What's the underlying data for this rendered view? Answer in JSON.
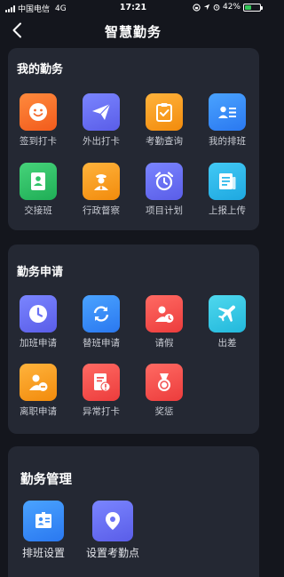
{
  "status_bar": {
    "carrier": "中国电信",
    "network": "4G",
    "time": "17:21",
    "battery": "42%",
    "battery_level": 0.42
  },
  "nav": {
    "title": "智慧勤务"
  },
  "sections": [
    {
      "title": "我的勤务",
      "items": [
        {
          "label": "签到打卡",
          "icon": "smile-icon",
          "color": "#f46a2c"
        },
        {
          "label": "外出打卡",
          "icon": "paper-plane-icon",
          "color": "#6b72f5"
        },
        {
          "label": "考勤查询",
          "icon": "clipboard-check-icon",
          "color": "#f7962a"
        },
        {
          "label": "我的排班",
          "icon": "id-card-icon",
          "color": "#3a8ef7"
        },
        {
          "label": "交接班",
          "icon": "handover-icon",
          "color": "#2fc267"
        },
        {
          "label": "行政督察",
          "icon": "officer-icon",
          "color": "#f7962a"
        },
        {
          "label": "项目计划",
          "icon": "alarm-clock-icon",
          "color": "#6b72f5"
        },
        {
          "label": "上报上传",
          "icon": "document-icon",
          "color": "#30b9ea"
        }
      ]
    },
    {
      "title": "勤务申请",
      "items": [
        {
          "label": "加班申请",
          "icon": "clock-icon",
          "color": "#6b72f5"
        },
        {
          "label": "替班申请",
          "icon": "swap-icon",
          "color": "#3a8ef7"
        },
        {
          "label": "请假",
          "icon": "person-clock-icon",
          "color": "#f25353"
        },
        {
          "label": "出差",
          "icon": "airplane-icon",
          "color": "#38c8e8"
        },
        {
          "label": "离职申请",
          "icon": "person-minus-icon",
          "color": "#f7962a"
        },
        {
          "label": "异常打卡",
          "icon": "alert-document-icon",
          "color": "#f25353"
        },
        {
          "label": "奖惩",
          "icon": "medal-icon",
          "color": "#f25353"
        }
      ]
    },
    {
      "title": "勤务管理",
      "items": [
        {
          "label": "排班设置",
          "icon": "schedule-card-icon",
          "color": "#3a8ef7"
        },
        {
          "label": "设置考勤点",
          "icon": "location-pin-icon",
          "color": "#6b72f5"
        }
      ]
    }
  ]
}
